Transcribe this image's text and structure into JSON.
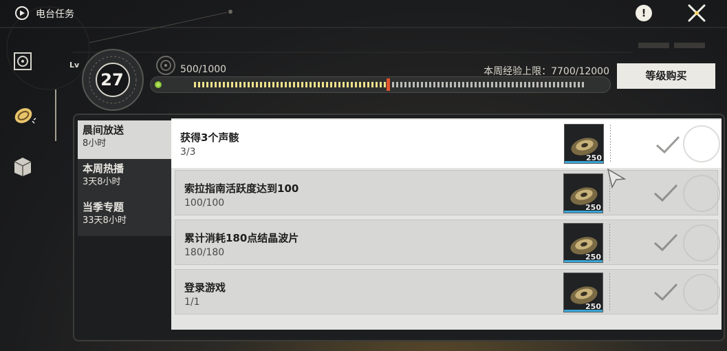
{
  "topbar": {
    "title": "电台任务"
  },
  "level": {
    "lv_label": "Lv",
    "value": "27"
  },
  "progress": {
    "xp_text": "500/1000",
    "week_limit_text": "本周经验上限：7700/12000",
    "fill_fraction": 0.5,
    "buy_label": "等级购买"
  },
  "categories": [
    {
      "name": "晨间放送",
      "time": "8小时"
    },
    {
      "name": "本周热播",
      "time": "3天8小时"
    },
    {
      "name": "当季专题",
      "time": "33天8小时"
    }
  ],
  "tasks": [
    {
      "title": "获得3个声骸",
      "progress": "3/3",
      "reward_count": "250"
    },
    {
      "title": "索拉指南活跃度达到100",
      "progress": "100/100",
      "reward_count": "250"
    },
    {
      "title": "累计消耗180点结晶波片",
      "progress": "180/180",
      "reward_count": "250"
    },
    {
      "title": "登录游戏",
      "progress": "1/1",
      "reward_count": "250"
    }
  ],
  "colors": {
    "accent_marker": "#e2552c",
    "progress_dot": "#5aa21a",
    "reward_bar": "#3aa6d6"
  }
}
